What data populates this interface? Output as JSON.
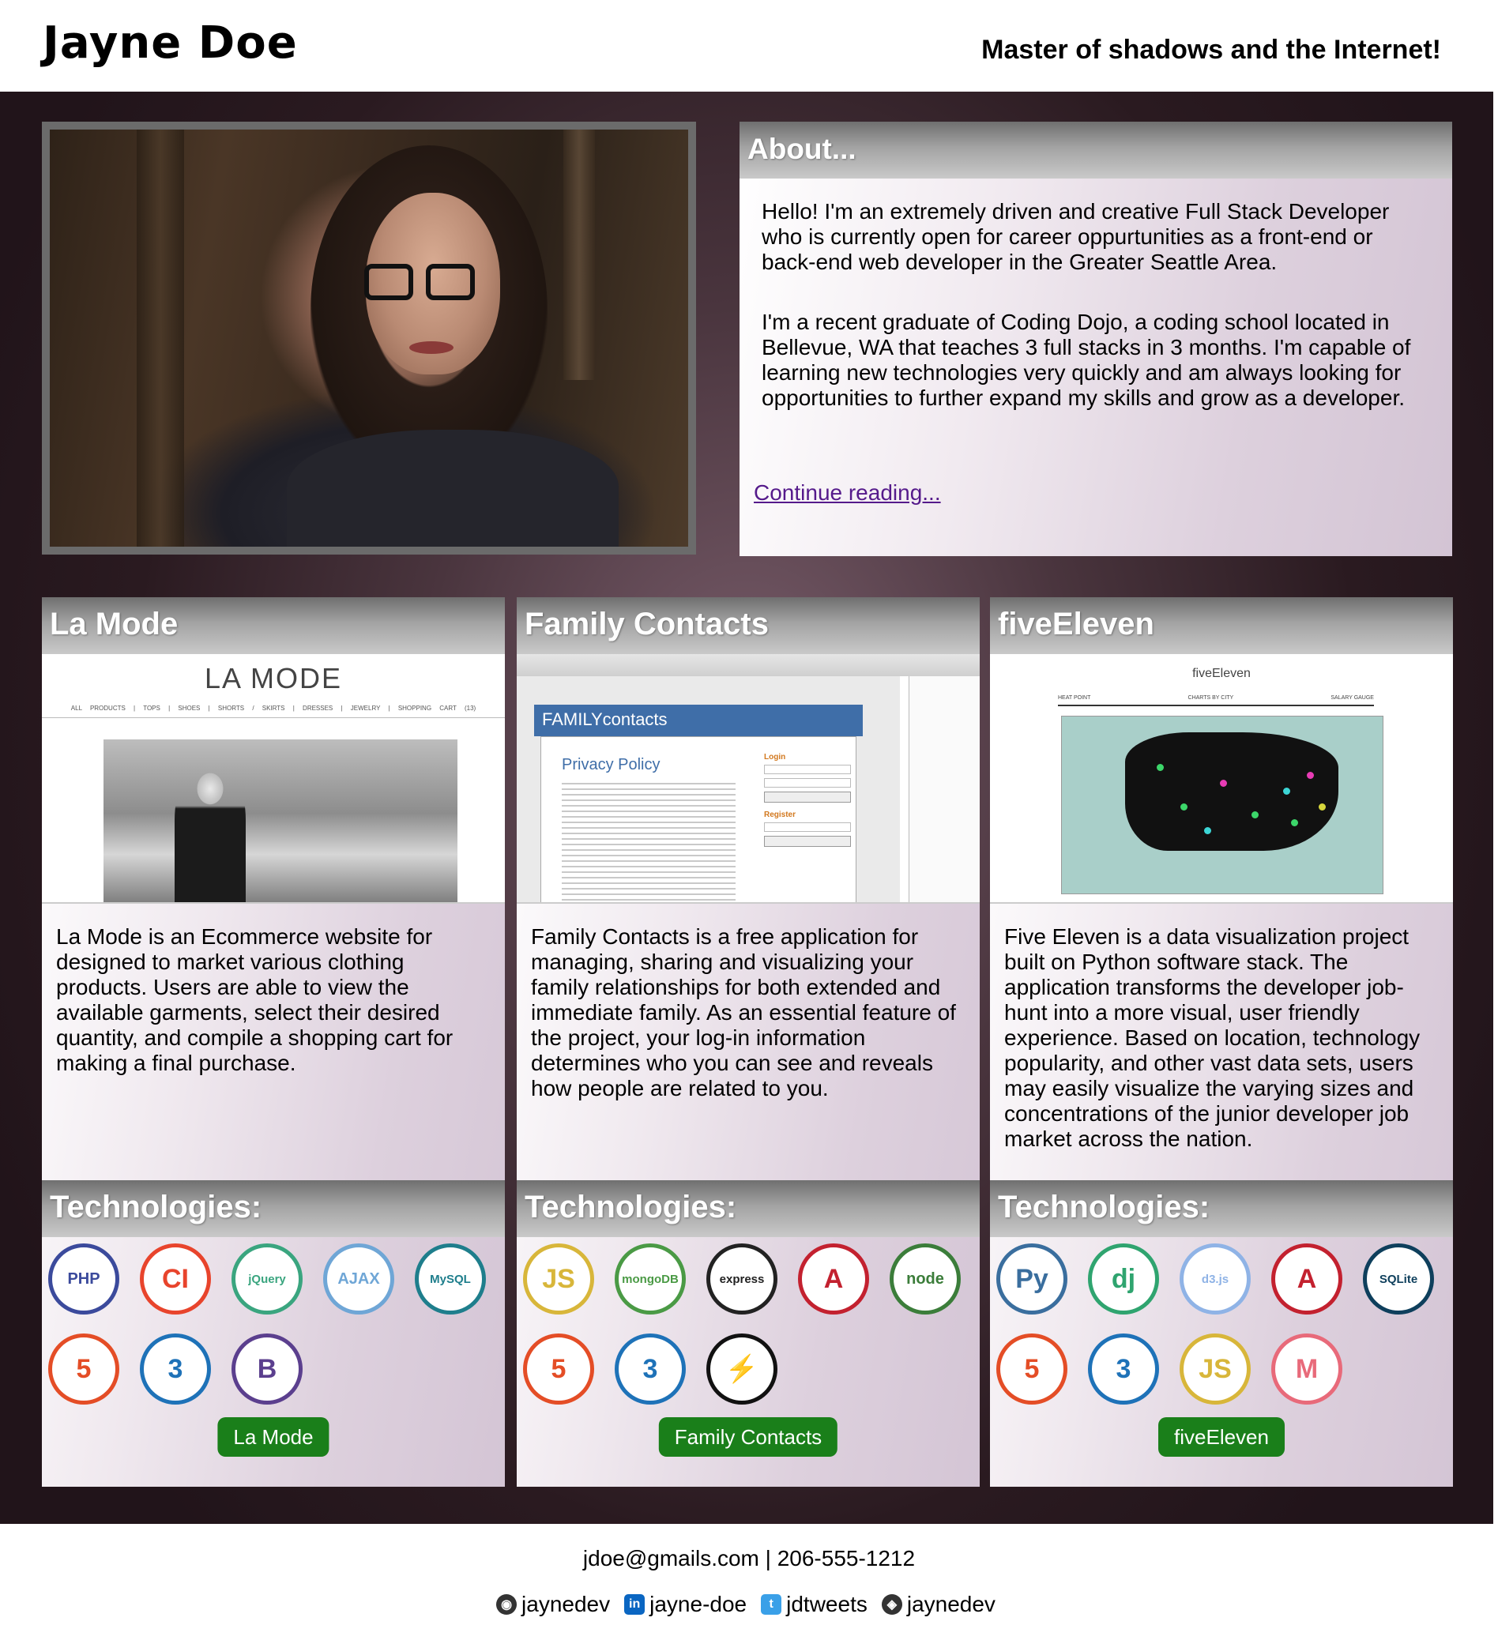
{
  "header": {
    "name": "Jayne Doe",
    "tagline": "Master of shadows and the Internet!"
  },
  "about": {
    "heading": "About...",
    "paragraphs": [
      "Hello! I'm an extremely driven and creative Full Stack Developer who is currently open for career oppurtunities as a front-end or back-end web developer in the Greater Seattle Area.",
      "I'm a recent graduate of Coding Dojo, a coding school located in Bellevue, WA that teaches 3 full stacks in 3 months. I'm capable of learning new technologies very quickly and am always looking for opportunities to further expand my skills and grow as a developer."
    ],
    "link": "Continue reading..."
  },
  "projects": [
    {
      "title": "La Mode",
      "description": "La Mode is an Ecommerce website for designed to market various clothing products. Users are able to view the available garments, select their desired quantity, and compile a shopping cart for making a final purchase.",
      "tech_heading": "Technologies:",
      "screenshot": {
        "logo": "LA MODE",
        "nav": "ALL PRODUCTS | TOPS | SHOES | SHORTS / SKIRTS | DRESSES | JEWELRY | SHOPPING CART (13)"
      },
      "technologies": [
        {
          "icon": "php-icon",
          "label": "PHP",
          "color": "#3b4a9c"
        },
        {
          "icon": "codeigniter-icon",
          "label": "CI",
          "color": "#e8442c"
        },
        {
          "icon": "jquery-icon",
          "label": "jQuery",
          "color": "#3aa57f"
        },
        {
          "icon": "ajax-icon",
          "label": "AJAX",
          "color": "#6fa6d6"
        },
        {
          "icon": "mysql-icon",
          "label": "MySQL",
          "color": "#1e7e8c"
        },
        {
          "icon": "html5-icon",
          "label": "5",
          "color": "#e44d26"
        },
        {
          "icon": "css3-icon",
          "label": "3",
          "color": "#1e72b8"
        },
        {
          "icon": "bootstrap-icon",
          "label": "B",
          "color": "#5b3f8e"
        }
      ],
      "button": "La Mode"
    },
    {
      "title": "Family Contacts",
      "description": "Family Contacts is a free application for managing, sharing and visualizing your family relationships for both extended and immediate family. As an essential feature of the project, your log-in information determines who you can see and reveals how people are related to you.",
      "tech_heading": "Technologies:",
      "screenshot": {
        "banner": "FAMILYcontacts",
        "title": "Privacy Policy",
        "login": "Login",
        "register": "Register"
      },
      "technologies": [
        {
          "icon": "javascript-icon",
          "label": "JS",
          "color": "#d8b63a"
        },
        {
          "icon": "mongodb-icon",
          "label": "mongoDB",
          "color": "#4a9a45"
        },
        {
          "icon": "express-icon",
          "label": "express",
          "color": "#222222"
        },
        {
          "icon": "angular-icon",
          "label": "A",
          "color": "#c3212f"
        },
        {
          "icon": "nodejs-icon",
          "label": "node",
          "color": "#3b7d3a"
        },
        {
          "icon": "html5-icon",
          "label": "5",
          "color": "#e44d26"
        },
        {
          "icon": "css3-icon",
          "label": "3",
          "color": "#1e72b8"
        },
        {
          "icon": "socketio-icon",
          "label": "⚡",
          "color": "#111111"
        }
      ],
      "button": "Family Contacts"
    },
    {
      "title": "fiveEleven",
      "description": "Five Eleven is a data visualization project built on Python software stack. The application transforms the developer job-hunt into a more visual, user friendly experience. Based on location, technology popularity, and other vast data sets, users may easily visualize the varying sizes and concentrations of the junior developer job market across the nation.",
      "tech_heading": "Technologies:",
      "screenshot": {
        "title": "fiveEleven",
        "tabs": [
          "HEAT POINT",
          "CHARTS BY CITY",
          "SALARY GAUGE"
        ]
      },
      "technologies": [
        {
          "icon": "python-icon",
          "label": "Py",
          "color": "#3a6e9e"
        },
        {
          "icon": "django-icon",
          "label": "dj",
          "color": "#2fa46f"
        },
        {
          "icon": "d3js-icon",
          "label": "d3.js",
          "color": "#8fb3e6"
        },
        {
          "icon": "angular-icon",
          "label": "A",
          "color": "#c3212f"
        },
        {
          "icon": "sqlite-icon",
          "label": "SQLite",
          "color": "#0e3f5c"
        },
        {
          "icon": "html5-icon",
          "label": "5",
          "color": "#e44d26"
        },
        {
          "icon": "css3-icon",
          "label": "3",
          "color": "#1e72b8"
        },
        {
          "icon": "javascript-icon",
          "label": "JS",
          "color": "#d8b63a"
        },
        {
          "icon": "materialize-icon",
          "label": "M",
          "color": "#e86a7a"
        }
      ],
      "button": "fiveEleven"
    }
  ],
  "footer": {
    "contact": "jdoe@gmails.com | 206-555-1212",
    "social": [
      {
        "icon": "github-icon",
        "label": "jaynedev",
        "color": "#333333"
      },
      {
        "icon": "linkedin-icon",
        "label": "jayne-doe",
        "color": "#0a66c2"
      },
      {
        "icon": "twitter-icon",
        "label": "jdtweets",
        "color": "#3aa0e8"
      },
      {
        "icon": "codepen-icon",
        "label": "jaynedev",
        "color": "#333333"
      }
    ]
  },
  "colors": {
    "accent_button": "#1a7f1a",
    "link": "#551a8b"
  }
}
